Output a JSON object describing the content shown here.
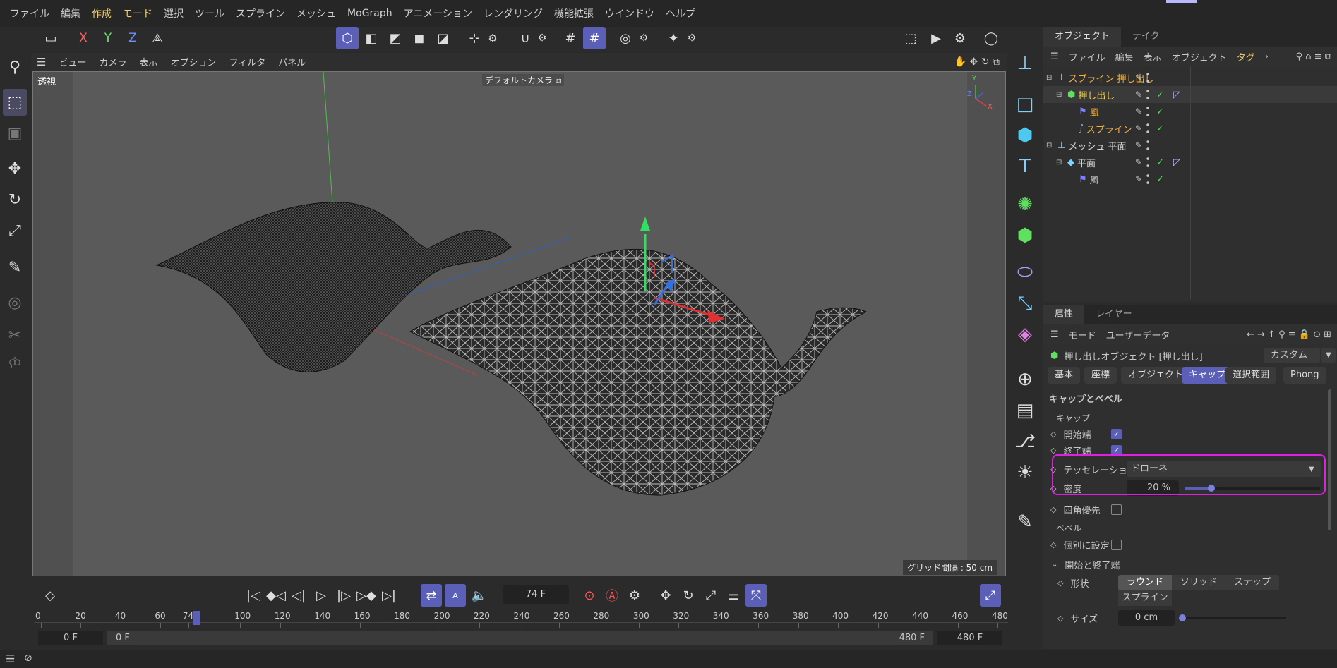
{
  "menubar": {
    "items": [
      "ファイル",
      "編集",
      "作成",
      "モード",
      "選択",
      "ツール",
      "スプライン",
      "メッシュ",
      "MoGraph",
      "アニメーション",
      "レンダリング",
      "機能拡張",
      "ウインドウ",
      "ヘルプ"
    ]
  },
  "toolbar": {
    "x": "X",
    "y": "Y",
    "z": "Z"
  },
  "viewport": {
    "menu": [
      "ビュー",
      "カメラ",
      "表示",
      "オプション",
      "フィルタ",
      "パネル"
    ],
    "view_label": "透視",
    "camera_label": "デフォルトカメラ",
    "grid_label": "グリッド間隔 : 50 cm",
    "axis_y": "Y",
    "axis_z": "Z",
    "axis_x": "X"
  },
  "object_manager": {
    "tabs": [
      "オブジェクト",
      "テイク"
    ],
    "menu": [
      "ファイル",
      "編集",
      "表示",
      "オブジェクト",
      "タグ"
    ],
    "rows": [
      {
        "name": "スプライン 押し出し",
        "color": "#f0b040"
      },
      {
        "name": "押し出し",
        "color": "#f0d040"
      },
      {
        "name": "風",
        "color": "#f0b040"
      },
      {
        "name": "スプライン",
        "color": "#f0b040"
      },
      {
        "name": "メッシュ 平面",
        "color": "#d8d8d8"
      },
      {
        "name": "平面",
        "color": "#d8d8d8"
      },
      {
        "name": "風",
        "color": "#d8d8d8"
      }
    ]
  },
  "attributes": {
    "tabs": [
      "属性",
      "レイヤー"
    ],
    "menu": [
      "モード",
      "ユーザーデータ"
    ],
    "object_title": "押し出しオブジェクト [押し出し]",
    "custom": "カスタム",
    "subtabs": [
      "基本",
      "座標",
      "オブジェクト",
      "キャップ",
      "選択範囲",
      "Phong"
    ],
    "section_title": "キャップとベベル",
    "cap_group": "キャップ",
    "start_cap": "開始端",
    "end_cap": "終了端",
    "tessellation_label": "テッセレーション",
    "tessellation_value": "ドローネ",
    "density_label": "密度",
    "density_value": "20 %",
    "density_fraction": 0.2,
    "quad_label": "四角優先",
    "bevel_group": "ベベル",
    "separate_label": "個別に設定",
    "start_end_group": "開始と終了端",
    "shape_label": "形状",
    "shape_options": [
      "ラウンド",
      "ソリッド",
      "ステップ",
      "スプライン"
    ],
    "size_label": "サイズ",
    "size_value": "0 cm"
  },
  "timeline": {
    "current_frame": "74 F",
    "ruler_ticks": [
      "0",
      "20",
      "40",
      "60",
      "74",
      "100",
      "120",
      "140",
      "160",
      "180",
      "200",
      "220",
      "240",
      "260",
      "280",
      "300",
      "320",
      "340",
      "360",
      "380",
      "400",
      "420",
      "440",
      "460",
      "480"
    ],
    "start_left": "0 F",
    "start_right": "0 F",
    "end_left": "480 F",
    "end_right": "480 F"
  },
  "colors": {
    "accent": "#5b5fb8",
    "highlight_box": "#e020e0"
  }
}
